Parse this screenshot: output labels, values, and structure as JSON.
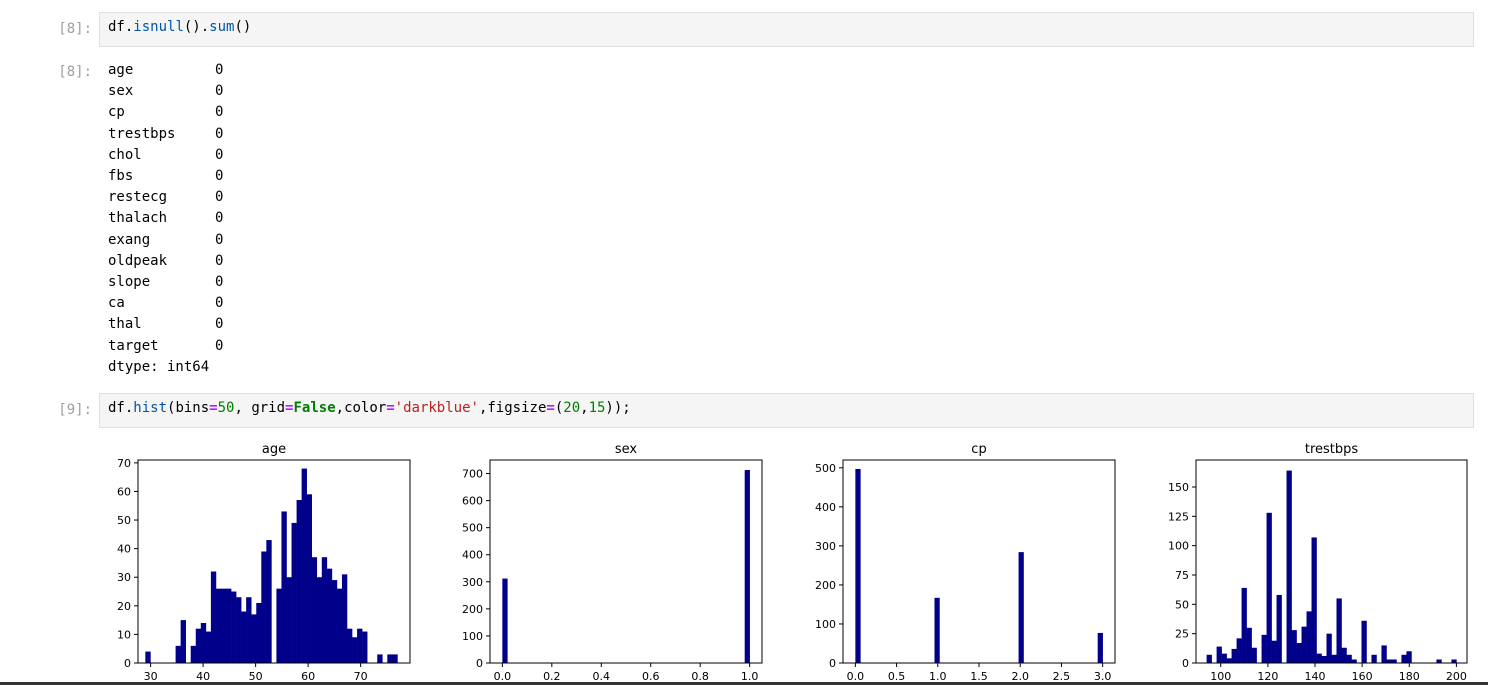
{
  "cells": {
    "c8": {
      "prompt_in": "[8]:",
      "prompt_out": "[8]:",
      "code": {
        "obj": "df",
        "dot1": ".",
        "fn1": "isnull",
        "p1": "()",
        "dot2": ".",
        "fn2": "sum",
        "p2": "()"
      },
      "output": [
        {
          "key": "age",
          "val": "0"
        },
        {
          "key": "sex",
          "val": "0"
        },
        {
          "key": "cp",
          "val": "0"
        },
        {
          "key": "trestbps",
          "val": "0"
        },
        {
          "key": "chol",
          "val": "0"
        },
        {
          "key": "fbs",
          "val": "0"
        },
        {
          "key": "restecg",
          "val": "0"
        },
        {
          "key": "thalach",
          "val": "0"
        },
        {
          "key": "exang",
          "val": "0"
        },
        {
          "key": "oldpeak",
          "val": "0"
        },
        {
          "key": "slope",
          "val": "0"
        },
        {
          "key": "ca",
          "val": "0"
        },
        {
          "key": "thal",
          "val": "0"
        },
        {
          "key": "target",
          "val": "0"
        }
      ],
      "dtype": "dtype: int64"
    },
    "c9": {
      "prompt_in": "[9]:",
      "code": {
        "t1": "df",
        "t2": ".",
        "t3": "hist",
        "t4": "(bins",
        "t5": "=",
        "t6": "50",
        "t7": ", grid",
        "t8": "=",
        "t9": "False",
        "t10": ",color",
        "t11": "=",
        "t12": "'darkblue'",
        "t13": ",figsize",
        "t14": "=",
        "t15": "(",
        "t16": "20",
        "t17": ",",
        "t18": "15",
        "t19": "));"
      }
    }
  },
  "bar_color": "#00008b",
  "chart_data": [
    {
      "type": "bar",
      "title": "age",
      "xlim": [
        27.6,
        79.4
      ],
      "ylim": [
        0,
        71
      ],
      "xticks": [
        30,
        40,
        50,
        60,
        70
      ],
      "yticks": [
        0,
        10,
        20,
        30,
        40,
        50,
        60,
        70
      ],
      "bin_start": 29,
      "bin_width": 0.96,
      "values": [
        4,
        0,
        0,
        0,
        0,
        0,
        6,
        15,
        0,
        6,
        12,
        14,
        11,
        32,
        26,
        26,
        26,
        25,
        23,
        18,
        23,
        17,
        21,
        39,
        43,
        0,
        26,
        53,
        30,
        49,
        57,
        68,
        59,
        37,
        30,
        37,
        33,
        29,
        26,
        31,
        12,
        9,
        12,
        11,
        0,
        0,
        3,
        0,
        3,
        3
      ]
    },
    {
      "type": "bar",
      "title": "sex",
      "xlim": [
        -0.05,
        1.05
      ],
      "ylim": [
        0,
        750
      ],
      "xticks": [
        0.0,
        0.2,
        0.4,
        0.6,
        0.8,
        1.0
      ],
      "xtick_labels": [
        "0.0",
        "0.2",
        "0.4",
        "0.6",
        "0.8",
        "1.0"
      ],
      "yticks": [
        0,
        100,
        200,
        300,
        400,
        500,
        600,
        700
      ],
      "bars": [
        {
          "x": 0.0,
          "w": 0.02,
          "value": 312
        },
        {
          "x": 0.98,
          "w": 0.02,
          "value": 713
        }
      ]
    },
    {
      "type": "bar",
      "title": "cp",
      "xlim": [
        -0.15,
        3.15
      ],
      "ylim": [
        0,
        520
      ],
      "xticks": [
        0.0,
        0.5,
        1.0,
        1.5,
        2.0,
        2.5,
        3.0
      ],
      "xtick_labels": [
        "0.0",
        "0.5",
        "1.0",
        "1.5",
        "2.0",
        "2.5",
        "3.0"
      ],
      "yticks": [
        0,
        100,
        200,
        300,
        400,
        500
      ],
      "bars": [
        {
          "x": 0.0,
          "w": 0.06,
          "value": 497
        },
        {
          "x": 0.96,
          "w": 0.06,
          "value": 167
        },
        {
          "x": 1.98,
          "w": 0.06,
          "value": 284
        },
        {
          "x": 2.94,
          "w": 0.06,
          "value": 77
        }
      ]
    },
    {
      "type": "bar",
      "title": "trestbps",
      "xlim": [
        89.5,
        204.5
      ],
      "ylim": [
        0,
        173
      ],
      "xticks": [
        100,
        120,
        140,
        160,
        180,
        200
      ],
      "yticks": [
        0,
        25,
        50,
        75,
        100,
        125,
        150
      ],
      "bin_start": 94,
      "bin_width": 2.12,
      "values": [
        7,
        0,
        14,
        8,
        4,
        12,
        21,
        64,
        30,
        13,
        0,
        24,
        128,
        19,
        58,
        0,
        164,
        28,
        17,
        31,
        44,
        107,
        8,
        6,
        25,
        7,
        55,
        13,
        7,
        3,
        0,
        36,
        0,
        7,
        0,
        15,
        3,
        3,
        0,
        7,
        10,
        0,
        0,
        0,
        0,
        0,
        3,
        0,
        0,
        3
      ]
    }
  ]
}
